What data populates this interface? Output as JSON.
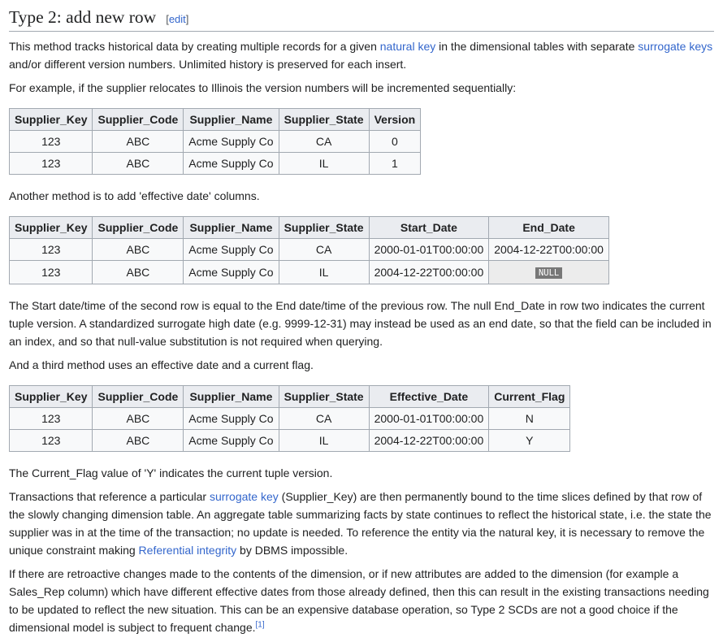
{
  "heading": {
    "title": "Type 2: add new row",
    "edit_open": "[",
    "edit": "edit",
    "edit_close": "]"
  },
  "blocks": [
    {
      "type": "p",
      "segments": [
        {
          "t": "This method tracks historical data by creating multiple records for a given "
        },
        {
          "t": "natural key",
          "link": true
        },
        {
          "t": " in the dimensional tables with separate "
        },
        {
          "t": "surrogate keys",
          "link": true
        },
        {
          "t": " and/or different version numbers. Unlimited history is preserved for each insert."
        }
      ]
    },
    {
      "type": "p",
      "segments": [
        {
          "t": "For example, if the supplier relocates to Illinois the version numbers will be incremented sequentially:"
        }
      ]
    },
    {
      "type": "table",
      "headers": [
        "Supplier_Key",
        "Supplier_Code",
        "Supplier_Name",
        "Supplier_State",
        "Version"
      ],
      "rows": [
        [
          "123",
          "ABC",
          "Acme Supply Co",
          "CA",
          "0"
        ],
        [
          "123",
          "ABC",
          "Acme Supply Co",
          "IL",
          "1"
        ]
      ]
    },
    {
      "type": "p",
      "segments": [
        {
          "t": "Another method is to add 'effective date' columns."
        }
      ]
    },
    {
      "type": "table",
      "headers": [
        "Supplier_Key",
        "Supplier_Code",
        "Supplier_Name",
        "Supplier_State",
        "Start_Date",
        "End_Date"
      ],
      "rows": [
        [
          "123",
          "ABC",
          "Acme Supply Co",
          "CA",
          "2000-01-01T00:00:00",
          "2004-12-22T00:00:00"
        ],
        [
          "123",
          "ABC",
          "Acme Supply Co",
          "IL",
          "2004-12-22T00:00:00",
          "NULL"
        ]
      ]
    },
    {
      "type": "p",
      "segments": [
        {
          "t": "The Start date/time of the second row is equal to the End date/time of the previous row. The null End_Date in row two indicates the current tuple version. A standardized surrogate high date (e.g. 9999-12-31) may instead be used as an end date, so that the field can be included in an index, and so that null-value substitution is not required when querying."
        }
      ]
    },
    {
      "type": "p",
      "segments": [
        {
          "t": "And a third method uses an effective date and a current flag."
        }
      ]
    },
    {
      "type": "table",
      "headers": [
        "Supplier_Key",
        "Supplier_Code",
        "Supplier_Name",
        "Supplier_State",
        "Effective_Date",
        "Current_Flag"
      ],
      "rows": [
        [
          "123",
          "ABC",
          "Acme Supply Co",
          "CA",
          "2000-01-01T00:00:00",
          "N"
        ],
        [
          "123",
          "ABC",
          "Acme Supply Co",
          "IL",
          "2004-12-22T00:00:00",
          "Y"
        ]
      ]
    },
    {
      "type": "p",
      "segments": [
        {
          "t": "The Current_Flag value of 'Y' indicates the current tuple version."
        }
      ]
    },
    {
      "type": "p",
      "segments": [
        {
          "t": "Transactions that reference a particular "
        },
        {
          "t": "surrogate key",
          "link": true
        },
        {
          "t": " (Supplier_Key) are then permanently bound to the time slices defined by that row of the slowly changing dimension table. An aggregate table summarizing facts by state continues to reflect the historical state, i.e. the state the supplier was in at the time of the transaction; no update is needed. To reference the entity via the natural key, it is necessary to remove the unique constraint making "
        },
        {
          "t": "Referential integrity",
          "link": true
        },
        {
          "t": " by DBMS impossible."
        }
      ]
    },
    {
      "type": "p",
      "segments": [
        {
          "t": "If there are retroactive changes made to the contents of the dimension, or if new attributes are added to the dimension (for example a Sales_Rep column) which have different effective dates from those already defined, then this can result in the existing transactions needing to be updated to reflect the new situation. This can be an expensive database operation, so Type 2 SCDs are not a good choice if the dimensional model is subject to frequent change."
        },
        {
          "t": "[1]",
          "link": true,
          "sup": true
        }
      ]
    }
  ]
}
